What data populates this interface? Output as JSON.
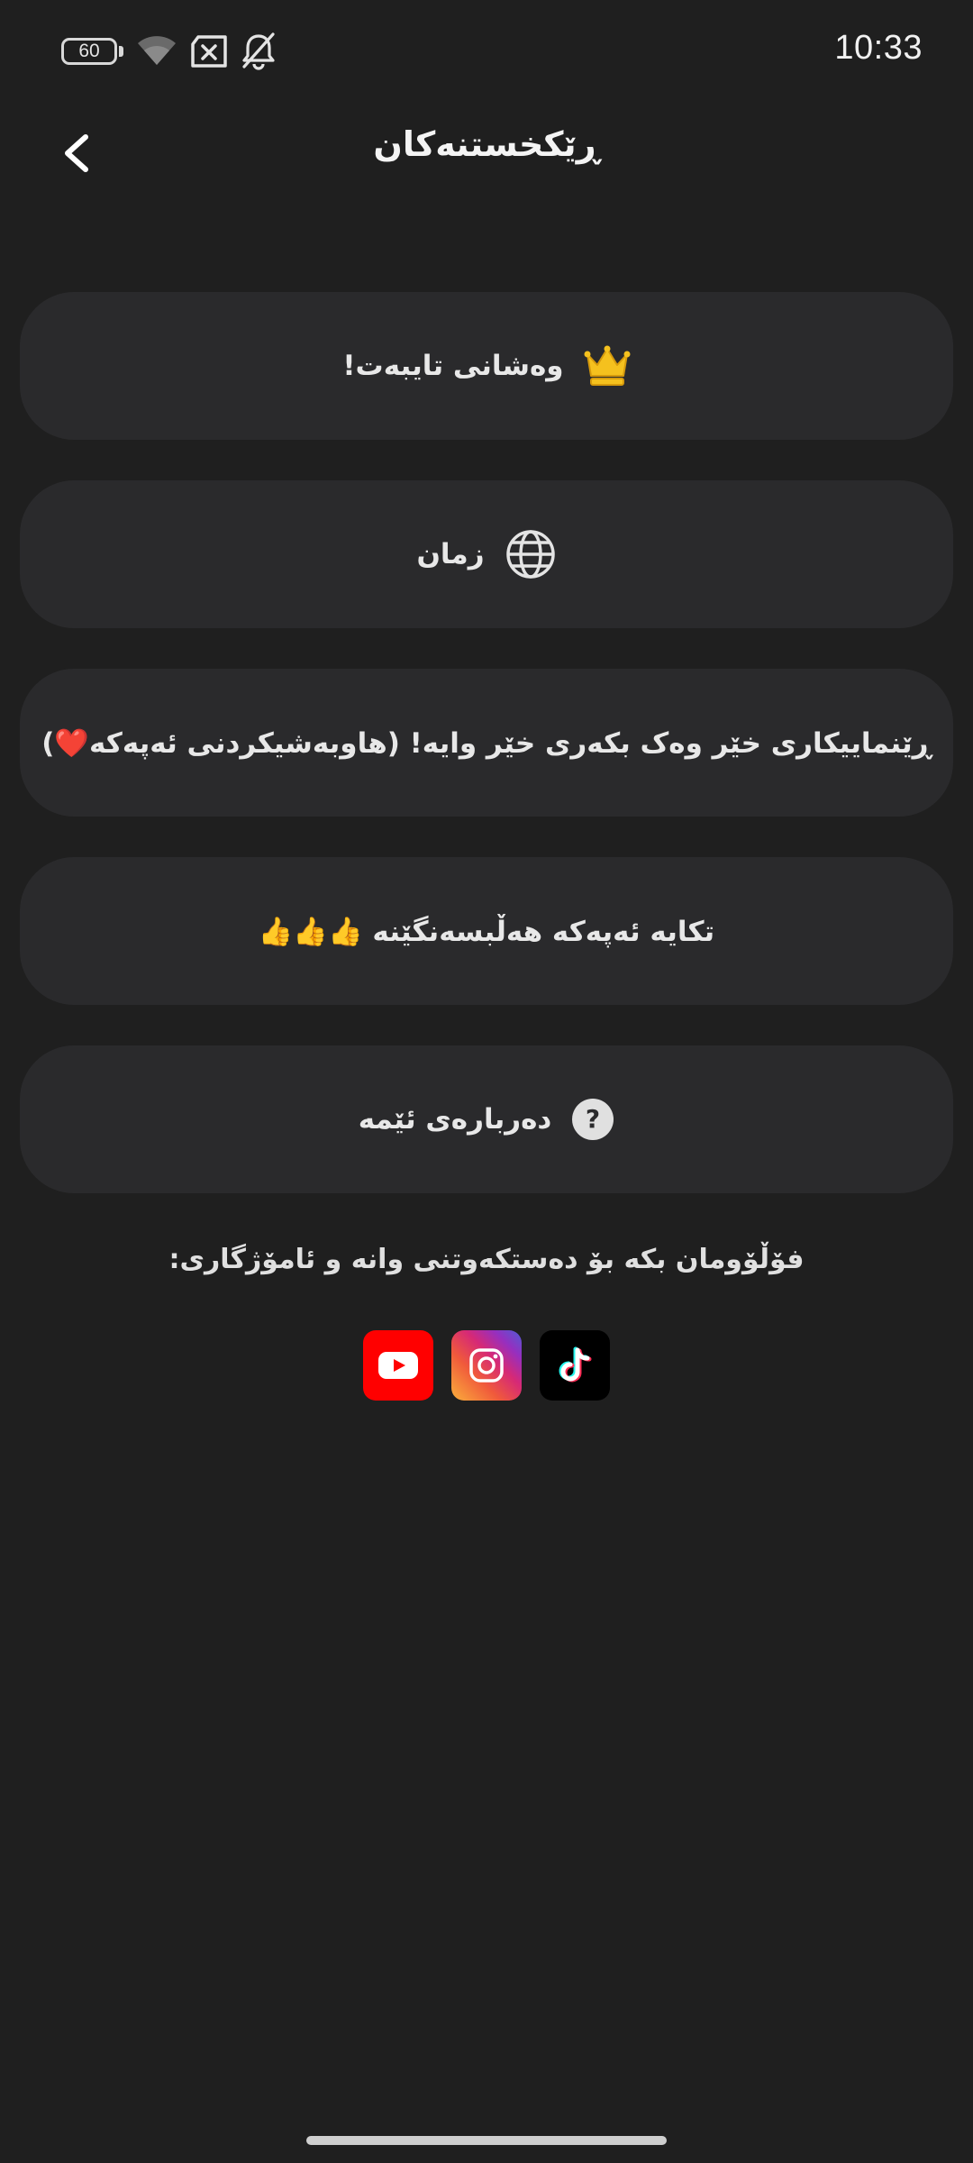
{
  "status_bar": {
    "battery_level": "60",
    "time": "10:33",
    "icons": [
      "wifi-icon",
      "no-sim-icon",
      "notifications-muted-icon"
    ]
  },
  "header": {
    "title": "ڕێکخستنەکان",
    "back_icon": "chevron-left-icon"
  },
  "settings": {
    "items": [
      {
        "label": "وەشانی تایبەت!",
        "icon": "crown-icon",
        "icon_color": "#f5c11e"
      },
      {
        "label": "زمان",
        "icon": "globe-icon"
      },
      {
        "label": "ڕێنماییکاری خێر وەک بکەری خێر وایە! (هاوبەشیکردنی ئەپەکە❤️)"
      },
      {
        "label": "تکایە ئەپەکە هەڵبسەنگێنە 👍👍👍"
      },
      {
        "label": "دەربارەی ئێمە",
        "icon": "help-icon"
      }
    ]
  },
  "follow": {
    "text": "فۆڵۆومان بکە بۆ دەستکەوتنی وانە و ئامۆژگاری:",
    "socials": [
      {
        "name": "YouTube",
        "icon": "youtube-icon",
        "color": "#ff0000"
      },
      {
        "name": "Instagram",
        "icon": "instagram-icon"
      },
      {
        "name": "TikTok",
        "icon": "tiktok-icon",
        "color": "#000000"
      }
    ]
  },
  "colors": {
    "background": "#1f1f1f",
    "card": "#2a2a2c",
    "text": "#e8e8e8"
  }
}
